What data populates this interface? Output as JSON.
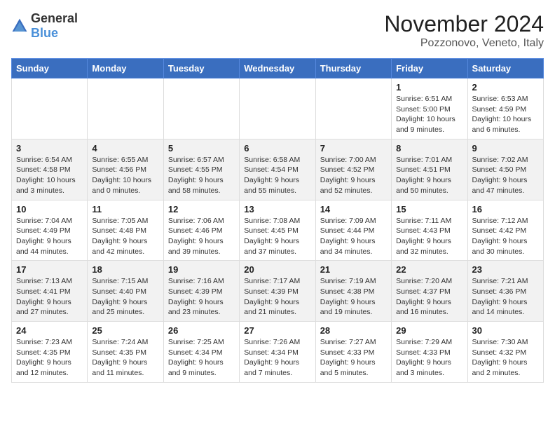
{
  "logo": {
    "general": "General",
    "blue": "Blue"
  },
  "title": "November 2024",
  "location": "Pozzonovo, Veneto, Italy",
  "weekdays": [
    "Sunday",
    "Monday",
    "Tuesday",
    "Wednesday",
    "Thursday",
    "Friday",
    "Saturday"
  ],
  "weeks": [
    [
      {
        "day": "",
        "info": ""
      },
      {
        "day": "",
        "info": ""
      },
      {
        "day": "",
        "info": ""
      },
      {
        "day": "",
        "info": ""
      },
      {
        "day": "",
        "info": ""
      },
      {
        "day": "1",
        "info": "Sunrise: 6:51 AM\nSunset: 5:00 PM\nDaylight: 10 hours and 9 minutes."
      },
      {
        "day": "2",
        "info": "Sunrise: 6:53 AM\nSunset: 4:59 PM\nDaylight: 10 hours and 6 minutes."
      }
    ],
    [
      {
        "day": "3",
        "info": "Sunrise: 6:54 AM\nSunset: 4:58 PM\nDaylight: 10 hours and 3 minutes."
      },
      {
        "day": "4",
        "info": "Sunrise: 6:55 AM\nSunset: 4:56 PM\nDaylight: 10 hours and 0 minutes."
      },
      {
        "day": "5",
        "info": "Sunrise: 6:57 AM\nSunset: 4:55 PM\nDaylight: 9 hours and 58 minutes."
      },
      {
        "day": "6",
        "info": "Sunrise: 6:58 AM\nSunset: 4:54 PM\nDaylight: 9 hours and 55 minutes."
      },
      {
        "day": "7",
        "info": "Sunrise: 7:00 AM\nSunset: 4:52 PM\nDaylight: 9 hours and 52 minutes."
      },
      {
        "day": "8",
        "info": "Sunrise: 7:01 AM\nSunset: 4:51 PM\nDaylight: 9 hours and 50 minutes."
      },
      {
        "day": "9",
        "info": "Sunrise: 7:02 AM\nSunset: 4:50 PM\nDaylight: 9 hours and 47 minutes."
      }
    ],
    [
      {
        "day": "10",
        "info": "Sunrise: 7:04 AM\nSunset: 4:49 PM\nDaylight: 9 hours and 44 minutes."
      },
      {
        "day": "11",
        "info": "Sunrise: 7:05 AM\nSunset: 4:48 PM\nDaylight: 9 hours and 42 minutes."
      },
      {
        "day": "12",
        "info": "Sunrise: 7:06 AM\nSunset: 4:46 PM\nDaylight: 9 hours and 39 minutes."
      },
      {
        "day": "13",
        "info": "Sunrise: 7:08 AM\nSunset: 4:45 PM\nDaylight: 9 hours and 37 minutes."
      },
      {
        "day": "14",
        "info": "Sunrise: 7:09 AM\nSunset: 4:44 PM\nDaylight: 9 hours and 34 minutes."
      },
      {
        "day": "15",
        "info": "Sunrise: 7:11 AM\nSunset: 4:43 PM\nDaylight: 9 hours and 32 minutes."
      },
      {
        "day": "16",
        "info": "Sunrise: 7:12 AM\nSunset: 4:42 PM\nDaylight: 9 hours and 30 minutes."
      }
    ],
    [
      {
        "day": "17",
        "info": "Sunrise: 7:13 AM\nSunset: 4:41 PM\nDaylight: 9 hours and 27 minutes."
      },
      {
        "day": "18",
        "info": "Sunrise: 7:15 AM\nSunset: 4:40 PM\nDaylight: 9 hours and 25 minutes."
      },
      {
        "day": "19",
        "info": "Sunrise: 7:16 AM\nSunset: 4:39 PM\nDaylight: 9 hours and 23 minutes."
      },
      {
        "day": "20",
        "info": "Sunrise: 7:17 AM\nSunset: 4:39 PM\nDaylight: 9 hours and 21 minutes."
      },
      {
        "day": "21",
        "info": "Sunrise: 7:19 AM\nSunset: 4:38 PM\nDaylight: 9 hours and 19 minutes."
      },
      {
        "day": "22",
        "info": "Sunrise: 7:20 AM\nSunset: 4:37 PM\nDaylight: 9 hours and 16 minutes."
      },
      {
        "day": "23",
        "info": "Sunrise: 7:21 AM\nSunset: 4:36 PM\nDaylight: 9 hours and 14 minutes."
      }
    ],
    [
      {
        "day": "24",
        "info": "Sunrise: 7:23 AM\nSunset: 4:35 PM\nDaylight: 9 hours and 12 minutes."
      },
      {
        "day": "25",
        "info": "Sunrise: 7:24 AM\nSunset: 4:35 PM\nDaylight: 9 hours and 11 minutes."
      },
      {
        "day": "26",
        "info": "Sunrise: 7:25 AM\nSunset: 4:34 PM\nDaylight: 9 hours and 9 minutes."
      },
      {
        "day": "27",
        "info": "Sunrise: 7:26 AM\nSunset: 4:34 PM\nDaylight: 9 hours and 7 minutes."
      },
      {
        "day": "28",
        "info": "Sunrise: 7:27 AM\nSunset: 4:33 PM\nDaylight: 9 hours and 5 minutes."
      },
      {
        "day": "29",
        "info": "Sunrise: 7:29 AM\nSunset: 4:33 PM\nDaylight: 9 hours and 3 minutes."
      },
      {
        "day": "30",
        "info": "Sunrise: 7:30 AM\nSunset: 4:32 PM\nDaylight: 9 hours and 2 minutes."
      }
    ]
  ]
}
